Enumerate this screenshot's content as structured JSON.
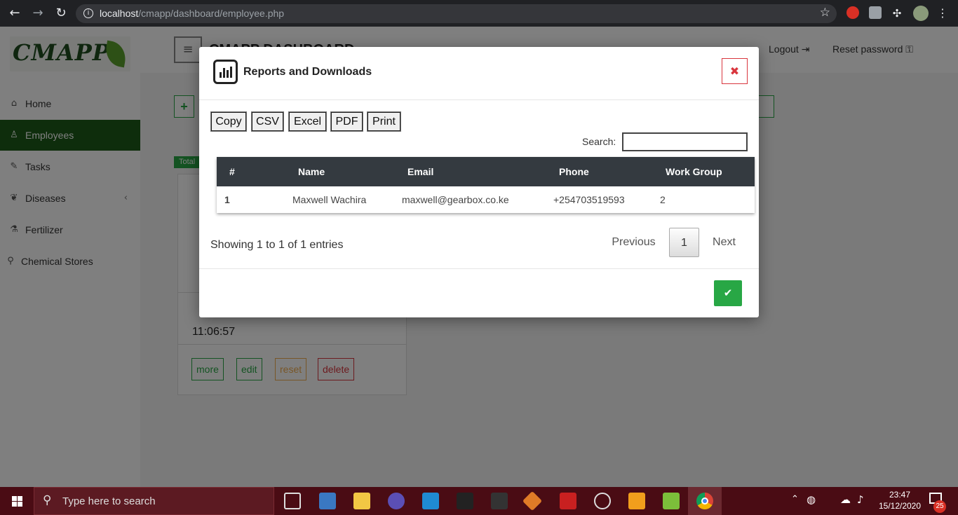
{
  "browser": {
    "url_host": "localhost",
    "url_path": "/cmapp/dashboard/employee.php"
  },
  "app": {
    "logo_text": "CMAPP",
    "header_title": "CMAPP DASHBOARD",
    "logout_label": "Logout",
    "reset_password_label": "Reset password"
  },
  "sidebar": {
    "items": [
      {
        "label": "Home",
        "icon": "home-icon"
      },
      {
        "label": "Employees",
        "icon": "user-icon"
      },
      {
        "label": "Tasks",
        "icon": "wrench-icon"
      },
      {
        "label": "Diseases",
        "icon": "leaf-icon"
      },
      {
        "label": "Fertilizer",
        "icon": "flask-icon"
      },
      {
        "label": "Chemical Stores",
        "icon": "map-marker-icon"
      }
    ]
  },
  "background": {
    "total_badge": "Total",
    "card_time": "11:06:57",
    "card_buttons": {
      "more": "more",
      "edit": "edit",
      "reset": "reset",
      "delete": "delete"
    }
  },
  "modal": {
    "title": "Reports and Downloads",
    "export_buttons": [
      "Copy",
      "CSV",
      "Excel",
      "PDF",
      "Print"
    ],
    "search_label": "Search:",
    "search_value": "",
    "table": {
      "headers": [
        "#",
        "Name",
        "Email",
        "Phone",
        "Work Group"
      ],
      "rows": [
        [
          "1",
          "Maxwell Wachira",
          "maxwell@gearbox.co.ke",
          "+254703519593",
          "2"
        ]
      ]
    },
    "info": "Showing 1 to 1 of 1 entries",
    "pagination": {
      "previous": "Previous",
      "current": "1",
      "next": "Next"
    }
  },
  "taskbar": {
    "search_placeholder": "Type here to search",
    "time": "23:47",
    "date": "15/12/2020",
    "notification_count": "25"
  }
}
